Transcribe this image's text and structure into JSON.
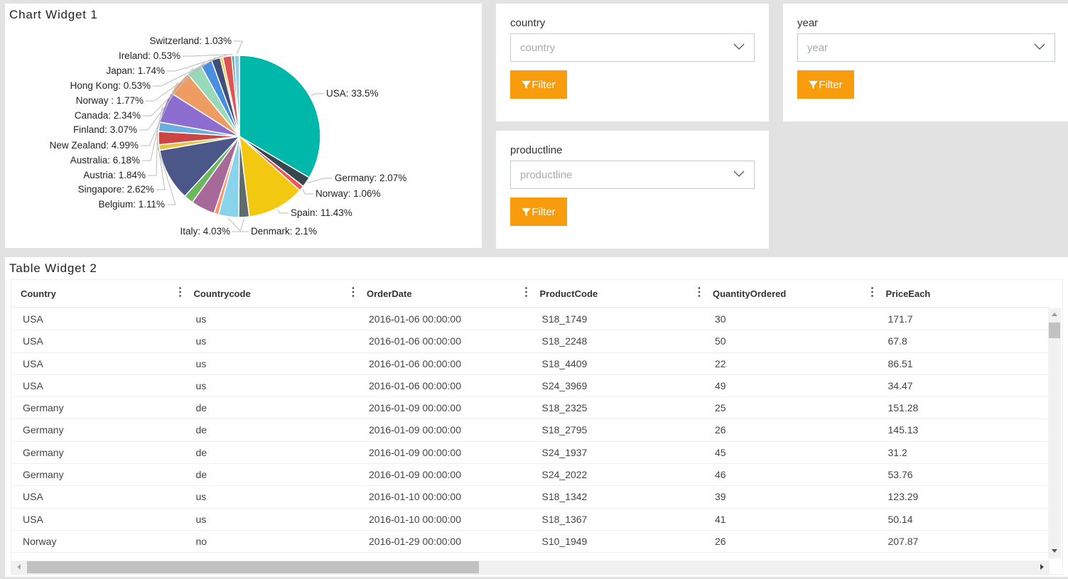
{
  "chart_widget": {
    "title": "Chart Widget 1"
  },
  "chart_data": {
    "type": "pie",
    "slices": [
      {
        "label": "USA: 33.5%",
        "value": 33.5,
        "color": "#00b8a9"
      },
      {
        "label": "Germany: 2.07%",
        "value": 2.07,
        "color": "#37474f"
      },
      {
        "label": "Norway: 1.06%",
        "value": 1.06,
        "color": "#f05454"
      },
      {
        "label": "Spain: 11.43%",
        "value": 11.43,
        "color": "#f2c811"
      },
      {
        "label": "Denmark: 2.1%",
        "value": 2.1,
        "color": "#5f6b6d"
      },
      {
        "label": "Italy: 4.03%",
        "value": 4.03,
        "color": "#8ad4eb"
      },
      {
        "label": "",
        "value": 0.9,
        "color": "#fe9666"
      },
      {
        "label": "",
        "value": 4.8,
        "color": "#a66999"
      },
      {
        "label": "",
        "value": 1.9,
        "color": "#6bb760"
      },
      {
        "label": "",
        "value": 10.46,
        "color": "#4a5788"
      },
      {
        "label": "Belgium: 1.11%",
        "value": 1.11,
        "color": "#e8c540"
      },
      {
        "label": "Singapore: 2.62%",
        "value": 2.62,
        "color": "#cc4444"
      },
      {
        "label": "Austria: 1.84%",
        "value": 1.84,
        "color": "#6aaee0"
      },
      {
        "label": "Australia: 6.18%",
        "value": 6.18,
        "color": "#8e6dd1"
      },
      {
        "label": "New Zealand: 4.99%",
        "value": 4.99,
        "color": "#ee9c62"
      },
      {
        "label": "Finland: 3.07%",
        "value": 3.07,
        "color": "#97d9b9"
      },
      {
        "label": "Canada: 2.34%",
        "value": 2.34,
        "color": "#4a8ee0"
      },
      {
        "label": "Norway : 1.77%",
        "value": 1.77,
        "color": "#3f4f7a"
      },
      {
        "label": "Hong Kong: 0.53%",
        "value": 0.53,
        "color": "#f5c518"
      },
      {
        "label": "Japan: 1.74%",
        "value": 1.74,
        "color": "#de5454"
      },
      {
        "label": "Ireland: 0.53%",
        "value": 0.53,
        "color": "#3aab7a"
      },
      {
        "label": "Switzerland: 1.03%",
        "value": 1.03,
        "color": "#9dc8f0"
      }
    ]
  },
  "filters": {
    "country": {
      "label": "country",
      "placeholder": "country",
      "button": "Filter"
    },
    "year": {
      "label": "year",
      "placeholder": "year",
      "button": "Filter"
    },
    "productline": {
      "label": "productline",
      "placeholder": "productline",
      "button": "Filter"
    }
  },
  "table_widget": {
    "title": "Table Widget 2",
    "columns": [
      "Country",
      "Countrycode",
      "OrderDate",
      "ProductCode",
      "QuantityOrdered",
      "PriceEach"
    ],
    "rows": [
      [
        "USA",
        "us",
        "2016-01-06 00:00:00",
        "S18_1749",
        "30",
        "171.7"
      ],
      [
        "USA",
        "us",
        "2016-01-06 00:00:00",
        "S18_2248",
        "50",
        "67.8"
      ],
      [
        "USA",
        "us",
        "2016-01-06 00:00:00",
        "S18_4409",
        "22",
        "86.51"
      ],
      [
        "USA",
        "us",
        "2016-01-06 00:00:00",
        "S24_3969",
        "49",
        "34.47"
      ],
      [
        "Germany",
        "de",
        "2016-01-09 00:00:00",
        "S18_2325",
        "25",
        "151.28"
      ],
      [
        "Germany",
        "de",
        "2016-01-09 00:00:00",
        "S18_2795",
        "26",
        "145.13"
      ],
      [
        "Germany",
        "de",
        "2016-01-09 00:00:00",
        "S24_1937",
        "45",
        "31.2"
      ],
      [
        "Germany",
        "de",
        "2016-01-09 00:00:00",
        "S24_2022",
        "46",
        "53.76"
      ],
      [
        "USA",
        "us",
        "2016-01-10 00:00:00",
        "S18_1342",
        "39",
        "123.29"
      ],
      [
        "USA",
        "us",
        "2016-01-10 00:00:00",
        "S18_1367",
        "41",
        "50.14"
      ],
      [
        "Norway",
        "no",
        "2016-01-29 00:00:00",
        "S10_1949",
        "26",
        "207.87"
      ]
    ]
  },
  "colors": {
    "accent": "#f89c0e",
    "background": "#e2e2e2"
  }
}
